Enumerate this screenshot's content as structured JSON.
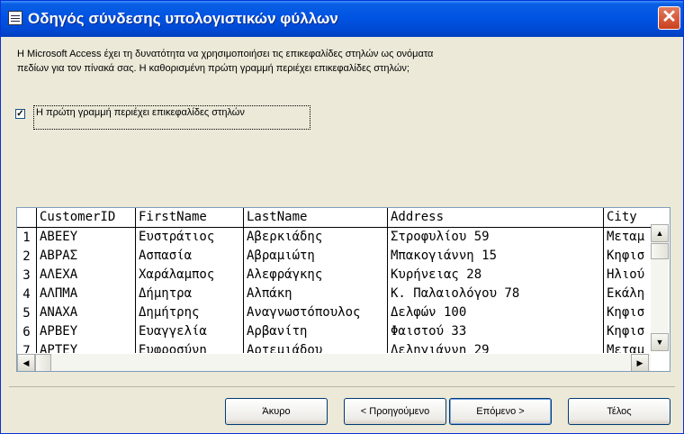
{
  "window": {
    "title": "Οδηγός σύνδεσης υπολογιστικών φύλλων",
    "close_glyph": "✕"
  },
  "description": {
    "line1": "Η Microsoft Access έχει τη δυνατότητα να χρησιμοποιήσει τις επικεφαλίδες στηλών ως ονόματα",
    "line2": "πεδίων για τον πίνακά σας. Η καθορισμένη πρώτη γραμμή περιέχει επικεφαλίδες στηλών;"
  },
  "checkbox": {
    "label": "Η πρώτη γραμμή περιέχει επικεφαλίδες στηλών",
    "checked": true,
    "mark": "✓"
  },
  "grid": {
    "columns": [
      "CustomerID",
      "FirstName",
      "LastName",
      "Address",
      "City"
    ],
    "rows": [
      {
        "num": "1",
        "cells": [
          "ΑΒΕΕΥ",
          "Ευστράτιος",
          "Αβερκιάδης",
          "Στροφυλίου 59",
          "Μεταμ"
        ]
      },
      {
        "num": "2",
        "cells": [
          "ΑΒΡΑΣ",
          "Ασπασία",
          "Αβραμιώτη",
          "Μπακογιάννη 15",
          "Κηφισ"
        ]
      },
      {
        "num": "3",
        "cells": [
          "ΑΛΕΧΑ",
          "Χαράλαμπος",
          "Αλεφράγκης",
          "Κυρήνειας 28",
          "Ηλιού"
        ]
      },
      {
        "num": "4",
        "cells": [
          "ΑΛΠΜΑ",
          "Δήμητρα",
          "Αλπάκη",
          "Κ. Παλαιολόγου 78",
          "Εκάλη"
        ]
      },
      {
        "num": "5",
        "cells": [
          "ΑΝΑΧΑ",
          "Δημήτρης",
          "Αναγνωστόπουλος",
          "Δελφών 100",
          "Κηφισ"
        ]
      },
      {
        "num": "6",
        "cells": [
          "ΑΡΒΕΥ",
          "Ευαγγελία",
          "Αρβανίτη",
          "Φαιστού 33",
          "Κηφισ"
        ]
      },
      {
        "num": "7",
        "cells": [
          "ΑΡΤΕΥ",
          "Ευφροσύνη",
          "Αρτεμιάδου",
          "Δεληγιάννη 29",
          "Μεταμ"
        ]
      }
    ]
  },
  "scroll": {
    "up": "▲",
    "down": "▼",
    "left": "◀",
    "right": "▶"
  },
  "buttons": {
    "cancel": "Άκυρο",
    "back": "< Προηγούμενο",
    "next": "Επόμενο >",
    "finish": "Τέλος"
  }
}
